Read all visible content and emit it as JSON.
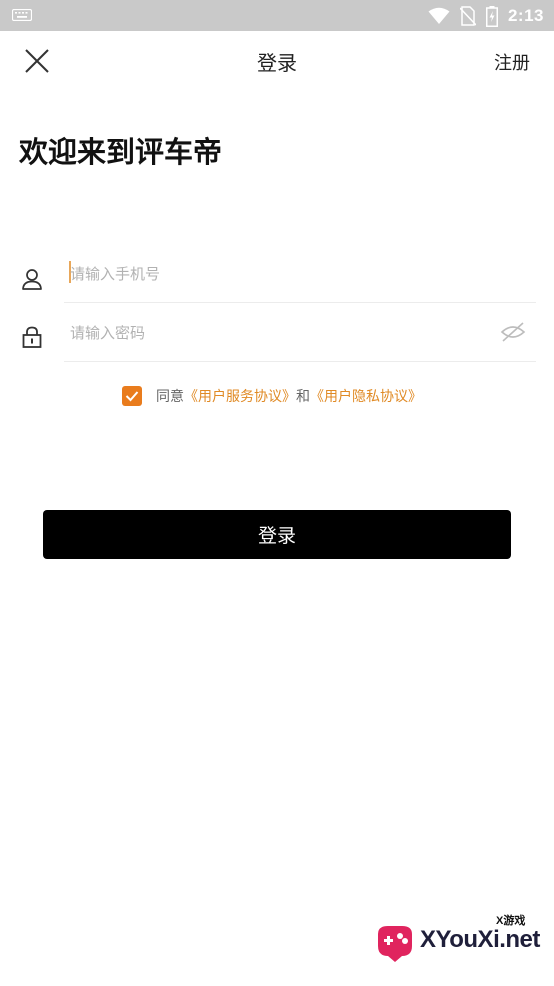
{
  "status_bar": {
    "time": "2:13",
    "icons": [
      "keyboard-icon",
      "wifi-icon",
      "no-sim-icon",
      "battery-charging-icon"
    ]
  },
  "nav": {
    "close_icon": "close-icon",
    "title": "登录",
    "register_label": "注册"
  },
  "welcome_text": "欢迎来到评车帝",
  "phone_field": {
    "icon": "user-icon",
    "placeholder": "请输入手机号",
    "value": ""
  },
  "password_field": {
    "icon": "lock-icon",
    "placeholder": "请输入密码",
    "value": "",
    "toggle_icon": "eye-hidden-icon"
  },
  "agreement": {
    "checked": true,
    "prefix": "同意",
    "terms_link": "《用户服务协议》",
    "conjunction": "和",
    "privacy_link": "《用户隐私协议》"
  },
  "login_button": "登录",
  "watermark": {
    "small_text": "X游戏",
    "brand": "XYouXi.net"
  },
  "colors": {
    "accent": "#e97c1d",
    "link": "#e08a25",
    "button": "#000000",
    "status_bar": "#c9c9c9"
  }
}
